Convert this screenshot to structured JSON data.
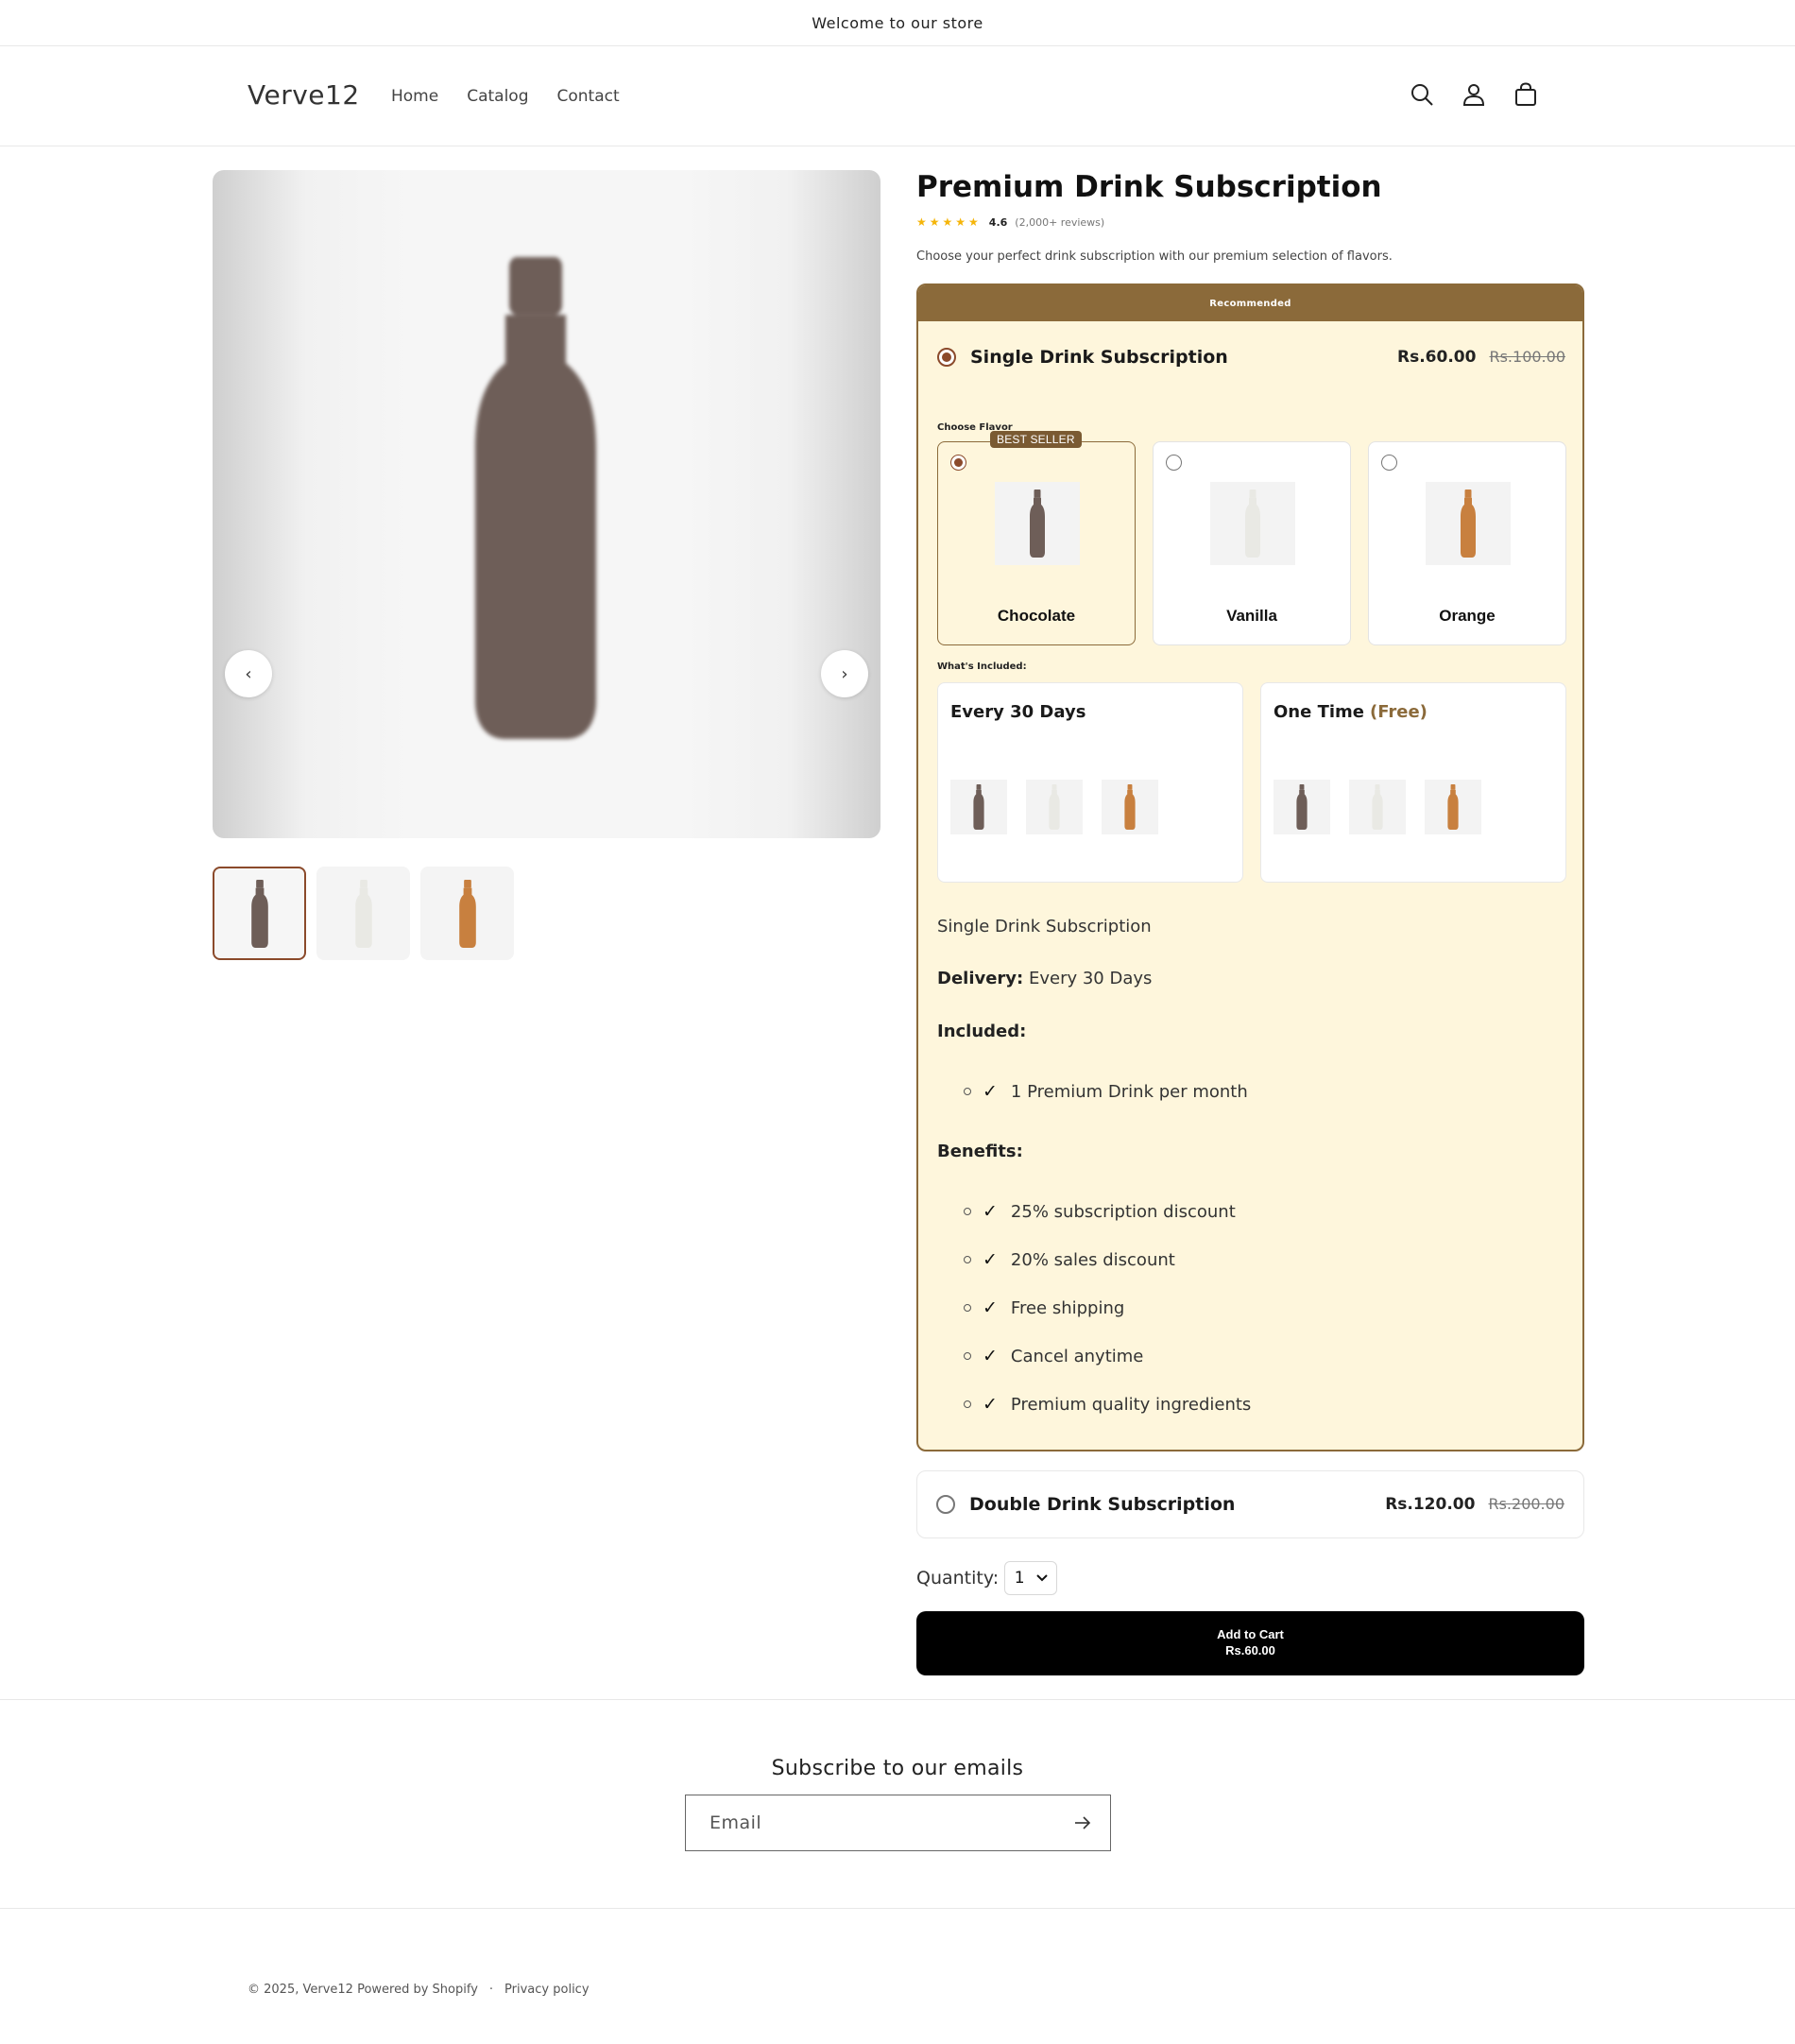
{
  "announcement": "Welcome to our store",
  "header": {
    "logo": "Verve12",
    "nav": [
      "Home",
      "Catalog",
      "Contact"
    ],
    "icons": [
      "search-icon",
      "account-icon",
      "cart-icon"
    ]
  },
  "gallery": {
    "prev_label": "‹",
    "next_label": "›",
    "thumbnails": [
      "Chocolate",
      "Vanilla",
      "Orange"
    ]
  },
  "product": {
    "title": "Premium Drink Subscription",
    "stars": "★★★★★",
    "rating": "4.6",
    "review_count": "(2,000+ reviews)",
    "description": "Choose your perfect drink subscription with our premium selection of flavors."
  },
  "offer1": {
    "ribbon": "Recommended",
    "name": "Single Drink Subscription",
    "price": "Rs.60.00",
    "compare_price": "Rs.100.00",
    "choose_flavor_label": "Choose Flavor",
    "best_seller_badge": "BEST SELLER",
    "flavors": [
      "Chocolate",
      "Vanilla",
      "Orange"
    ],
    "whats_included_label": "What's Included:",
    "included": [
      {
        "title": "Every 30 Days",
        "suffix": ""
      },
      {
        "title": "One Time",
        "suffix": "(Free)"
      }
    ],
    "details": {
      "plan_name": "Single Drink Subscription",
      "delivery_label": "Delivery:",
      "delivery_value": "Every 30 Days",
      "included_label": "Included:",
      "included_items": [
        "1 Premium Drink per month"
      ],
      "benefits_label": "Benefits:",
      "benefits": [
        "25% subscription discount",
        "20% sales discount",
        "Free shipping",
        "Cancel anytime",
        "Premium quality ingredients"
      ]
    }
  },
  "offer2": {
    "name": "Double Drink Subscription",
    "price": "Rs.120.00",
    "compare_price": "Rs.200.00"
  },
  "quantity": {
    "label": "Quantity:",
    "value": "1"
  },
  "add_to_cart": {
    "label": "Add to Cart",
    "price": "Rs.60.00"
  },
  "newsletter": {
    "title": "Subscribe to our emails",
    "placeholder": "Email"
  },
  "footer": {
    "copyright": "© 2025, Verve12 Powered by Shopify",
    "separator": "·",
    "privacy": "Privacy policy"
  },
  "colors": {
    "chocolate": "#6e5e58",
    "vanilla": "#e9e9e4",
    "orange": "#c8803f",
    "accent": "#8b6a3a",
    "offer_bg": "#fef6dc"
  }
}
